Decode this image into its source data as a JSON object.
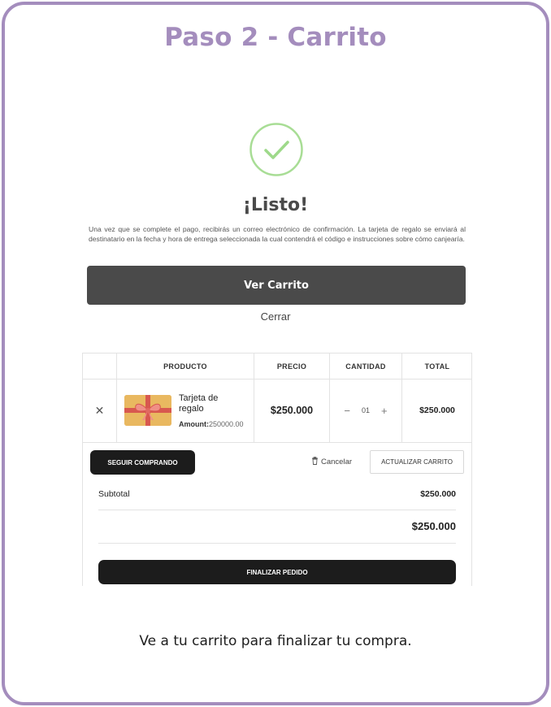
{
  "step_title": "Paso 2 - Carrito",
  "modal": {
    "heading": "¡Listo!",
    "message": "Una vez que se complete el pago, recibirás un correo electrónico de confirmación. La tarjeta de regalo se enviará al destinatario en la fecha y hora de entrega seleccionada la cual contendrá el código e instrucciones sobre cómo canjearía.",
    "primary_button": "Ver Carrito",
    "close_link": "Cerrar",
    "check_icon": "check-circle-icon",
    "check_color": "#9ed98a"
  },
  "cart": {
    "headers": [
      "PRODUCTO",
      "PRECIO",
      "CANTIDAD",
      "TOTAL"
    ],
    "item": {
      "remove_icon": "close-icon",
      "name": "Tarjeta de regalo",
      "amount_label": "Amount:",
      "amount_value": "250000.00",
      "price": "$250.000",
      "quantity": "01",
      "minus": "−",
      "plus": "+",
      "total": "$250.000"
    },
    "continue_button": "SEGUIR COMPRANDO",
    "cancel_label": "Cancelar",
    "update_button": "ACTUALIZAR CARRITO",
    "subtotal_label": "Subtotal",
    "subtotal_value": "$250.000",
    "total_value": "$250.000",
    "checkout_button": "FINALIZAR PEDIDO"
  },
  "footer_text": "Ve a tu carrito para finalizar tu compra.",
  "colors": {
    "accent": "#a48dbd",
    "dark_button": "#1c1c1c",
    "primary_button": "#4a4a4a"
  }
}
